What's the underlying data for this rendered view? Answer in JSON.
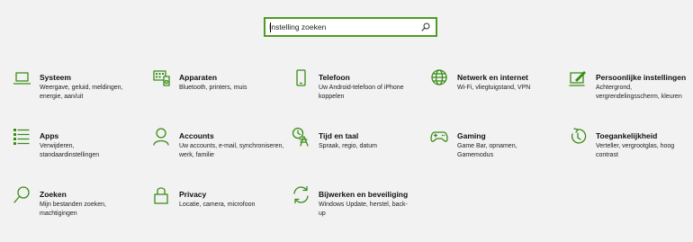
{
  "search": {
    "placeholder": "Instelling zoeken",
    "icon": "search-icon"
  },
  "colors": {
    "accent": "#3a8c17",
    "search_border": "#4f9b23",
    "background": "#f2f2f2"
  },
  "tiles": [
    {
      "icon": "laptop-icon",
      "title": "Systeem",
      "desc": "Weergave, geluid, meldingen, energie, aan/uit"
    },
    {
      "icon": "keyboard-icon",
      "title": "Apparaten",
      "desc": "Bluetooth, printers, muis"
    },
    {
      "icon": "phone-icon",
      "title": "Telefoon",
      "desc": "Uw Android-telefoon of iPhone koppelen"
    },
    {
      "icon": "globe-icon",
      "title": "Netwerk en internet",
      "desc": "Wi-Fi, vliegtuigstand, VPN"
    },
    {
      "icon": "paint-icon",
      "title": "Persoonlijke instellingen",
      "desc": "Achtergrond, vergrendelingsscherm, kleuren"
    },
    {
      "icon": "apps-list-icon",
      "title": "Apps",
      "desc": "Verwijderen, standaardinstellingen"
    },
    {
      "icon": "person-icon",
      "title": "Accounts",
      "desc": "Uw accounts, e-mail, synchroniseren, werk, familie"
    },
    {
      "icon": "time-language-icon",
      "title": "Tijd en taal",
      "desc": "Spraak, regio, datum"
    },
    {
      "icon": "gamepad-icon",
      "title": "Gaming",
      "desc": "Game Bar, opnamen, Gamemodus"
    },
    {
      "icon": "ease-of-access-icon",
      "title": "Toegankelijkheid",
      "desc": "Verteller, vergrootglas, hoog contrast"
    },
    {
      "icon": "search-icon",
      "title": "Zoeken",
      "desc": "Mijn bestanden zoeken, machtigingen"
    },
    {
      "icon": "lock-icon",
      "title": "Privacy",
      "desc": "Locatie, camera, microfoon"
    },
    {
      "icon": "sync-icon",
      "title": "Bijwerken en beveiliging",
      "desc": "Windows Update, herstel, back-up"
    }
  ]
}
